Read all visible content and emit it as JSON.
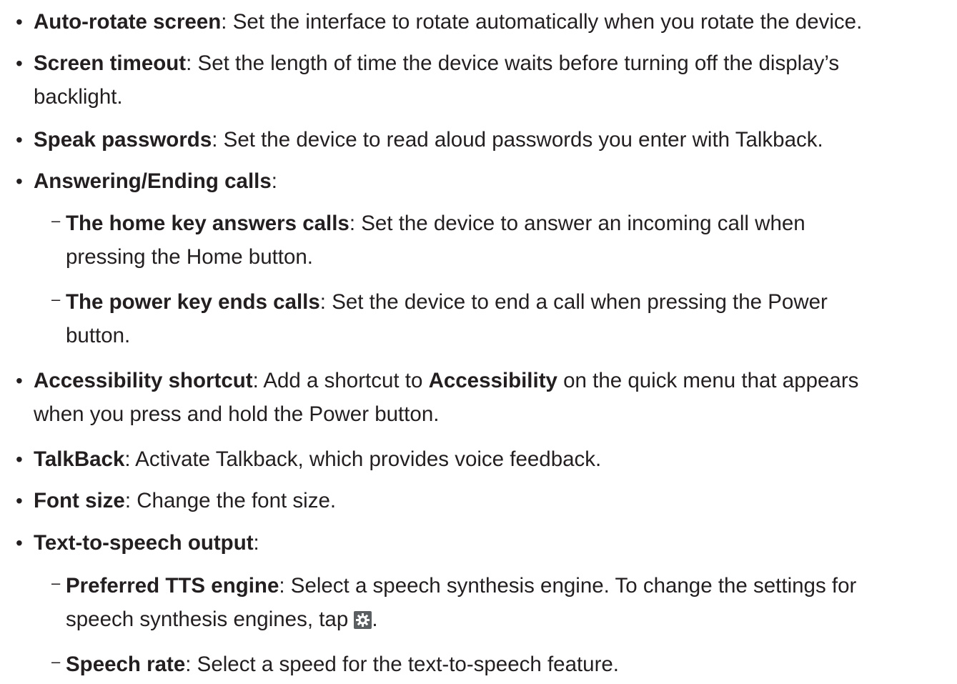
{
  "items": [
    {
      "term": "Auto-rotate screen",
      "sep": ": ",
      "desc": "Set the interface to rotate automatically when you rotate the device."
    },
    {
      "term": "Screen timeout",
      "sep": ": ",
      "desc": "Set the length of time the device waits before turning off the display’s",
      "desc2": "backlight."
    },
    {
      "term": "Speak passwords",
      "sep": ": ",
      "desc": "Set the device to read aloud passwords you enter with Talkback."
    },
    {
      "term": "Answering/Ending calls",
      "sep": ":"
    },
    {
      "term": "The home key answers calls",
      "sep": ": ",
      "desc": "Set the device to answer an incoming call when",
      "desc2": "pressing the Home button."
    },
    {
      "term": "The power key ends calls",
      "sep": ": ",
      "desc": "Set the device to end a call when pressing the Power",
      "desc2": "button."
    },
    {
      "term": "Accessibility shortcut",
      "sep": ": ",
      "desc_a": "Add a shortcut to ",
      "desc_bold": "Accessibility",
      "desc_b": " on the quick menu that appears",
      "desc2": "when you press and hold the Power button."
    },
    {
      "term": "TalkBack",
      "sep": ": ",
      "desc": "Activate Talkback, which provides voice feedback."
    },
    {
      "term": "Font size",
      "sep": ": ",
      "desc": "Change the font size."
    },
    {
      "term": "Text-to-speech output",
      "sep": ":"
    },
    {
      "term": "Preferred TTS engine",
      "sep": ": ",
      "desc": "Select a speech synthesis engine. To change the settings for",
      "desc2_a": "speech synthesis engines, tap ",
      "desc2_icon": "gear-icon",
      "desc2_b": "."
    },
    {
      "term": "Speech rate",
      "sep": ": ",
      "desc": "Select a speed for the text-to-speech feature."
    }
  ],
  "bullet_char": "•",
  "dash_char": "–"
}
